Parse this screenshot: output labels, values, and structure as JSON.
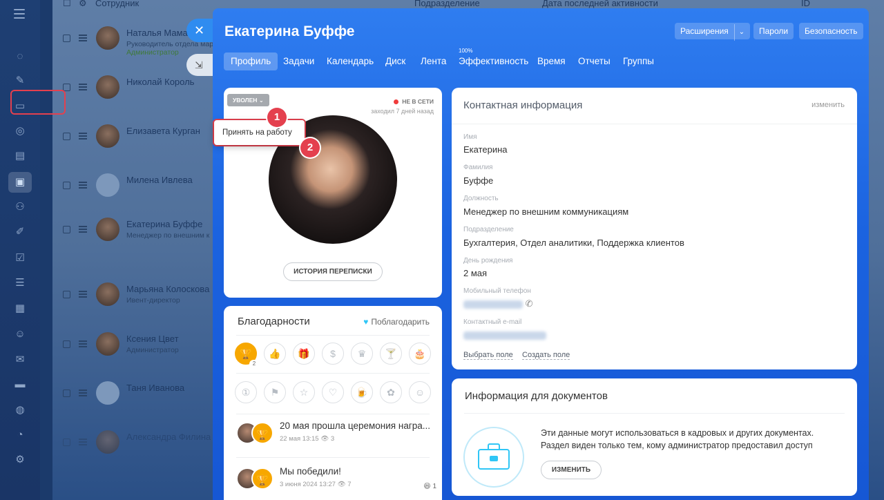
{
  "list_header": {
    "employee": "Сотрудник",
    "department": "Подразделение",
    "last_activity": "Дата последней активности",
    "id": "ID"
  },
  "employees": [
    {
      "name": "Наталья Мамаев",
      "role": "Руководитель отдела мар",
      "badge": "Администратор"
    },
    {
      "name": "Николай Король",
      "role": "",
      "badge": ""
    },
    {
      "name": "Елизавета Курган",
      "role": "",
      "badge": ""
    },
    {
      "name": "Милена Ивлева",
      "role": "",
      "badge": ""
    },
    {
      "name": "Екатерина Буффе",
      "role": "Менеджер по внешним к",
      "badge": ""
    },
    {
      "name": "Марьяна Колоскова",
      "role": "Ивент-директор",
      "badge": ""
    },
    {
      "name": "Ксения Цвет",
      "role": "",
      "badge": "Администратор"
    },
    {
      "name": "Таня Иванова",
      "role": "",
      "badge": ""
    },
    {
      "name": "Александра Филина",
      "role": "",
      "badge": ""
    }
  ],
  "slider": {
    "title": "Екатерина Буффе",
    "buttons": {
      "extensions": "Расширения",
      "passwords": "Пароли",
      "security": "Безопасность"
    },
    "tabs": [
      "Профиль",
      "Задачи",
      "Календарь",
      "Диск",
      "Лента",
      "Эффективность",
      "Время",
      "Отчеты",
      "Группы"
    ],
    "efficiency_pct": "100%"
  },
  "profile": {
    "status": "УВОЛЕН",
    "status_menu_item": "Принять на работу",
    "online_status": "НЕ В СЕТИ",
    "last_seen": "заходил 7 дней назад",
    "history_button": "ИСТОРИЯ ПЕРЕПИСКИ",
    "callouts": [
      "1",
      "2"
    ]
  },
  "thanks": {
    "title": "Благодарности",
    "action": "Поблагодарить",
    "gold_count": "2",
    "posts": [
      {
        "text": "20 мая прошла церемония награ...",
        "meta": "22 мая 13:15",
        "views": "3",
        "reaction_count": ""
      },
      {
        "text": "Мы победили!",
        "meta": "3 июня 2024 13:27",
        "views": "7",
        "reaction_count": "1"
      }
    ]
  },
  "contact": {
    "title": "Контактная информация",
    "edit": "изменить",
    "fields": [
      {
        "label": "Имя",
        "value": "Екатерина"
      },
      {
        "label": "Фамилия",
        "value": "Буффе"
      },
      {
        "label": "Должность",
        "value": "Менеджер по внешним коммуникациям"
      },
      {
        "label": "Подразделение",
        "value": "Бухгалтерия, Отдел аналитики, Поддержка клиентов"
      },
      {
        "label": "День рождения",
        "value": "2 мая"
      },
      {
        "label": "Мобильный телефон",
        "value": ""
      },
      {
        "label": "Контактный e-mail",
        "value": ""
      }
    ],
    "select_field": "Выбрать поле",
    "create_field": "Создать поле"
  },
  "docs": {
    "title": "Информация для документов",
    "line1": "Эти данные могут использоваться в кадровых и других документах.",
    "line2": "Раздел виден только тем, кому администратор предоставил доступ",
    "button": "ИЗМЕНИТЬ"
  },
  "colors": {
    "accent": "#2f7df0",
    "callout": "#e4404e",
    "gold": "#f7a700",
    "offline": "#f03c3c"
  }
}
